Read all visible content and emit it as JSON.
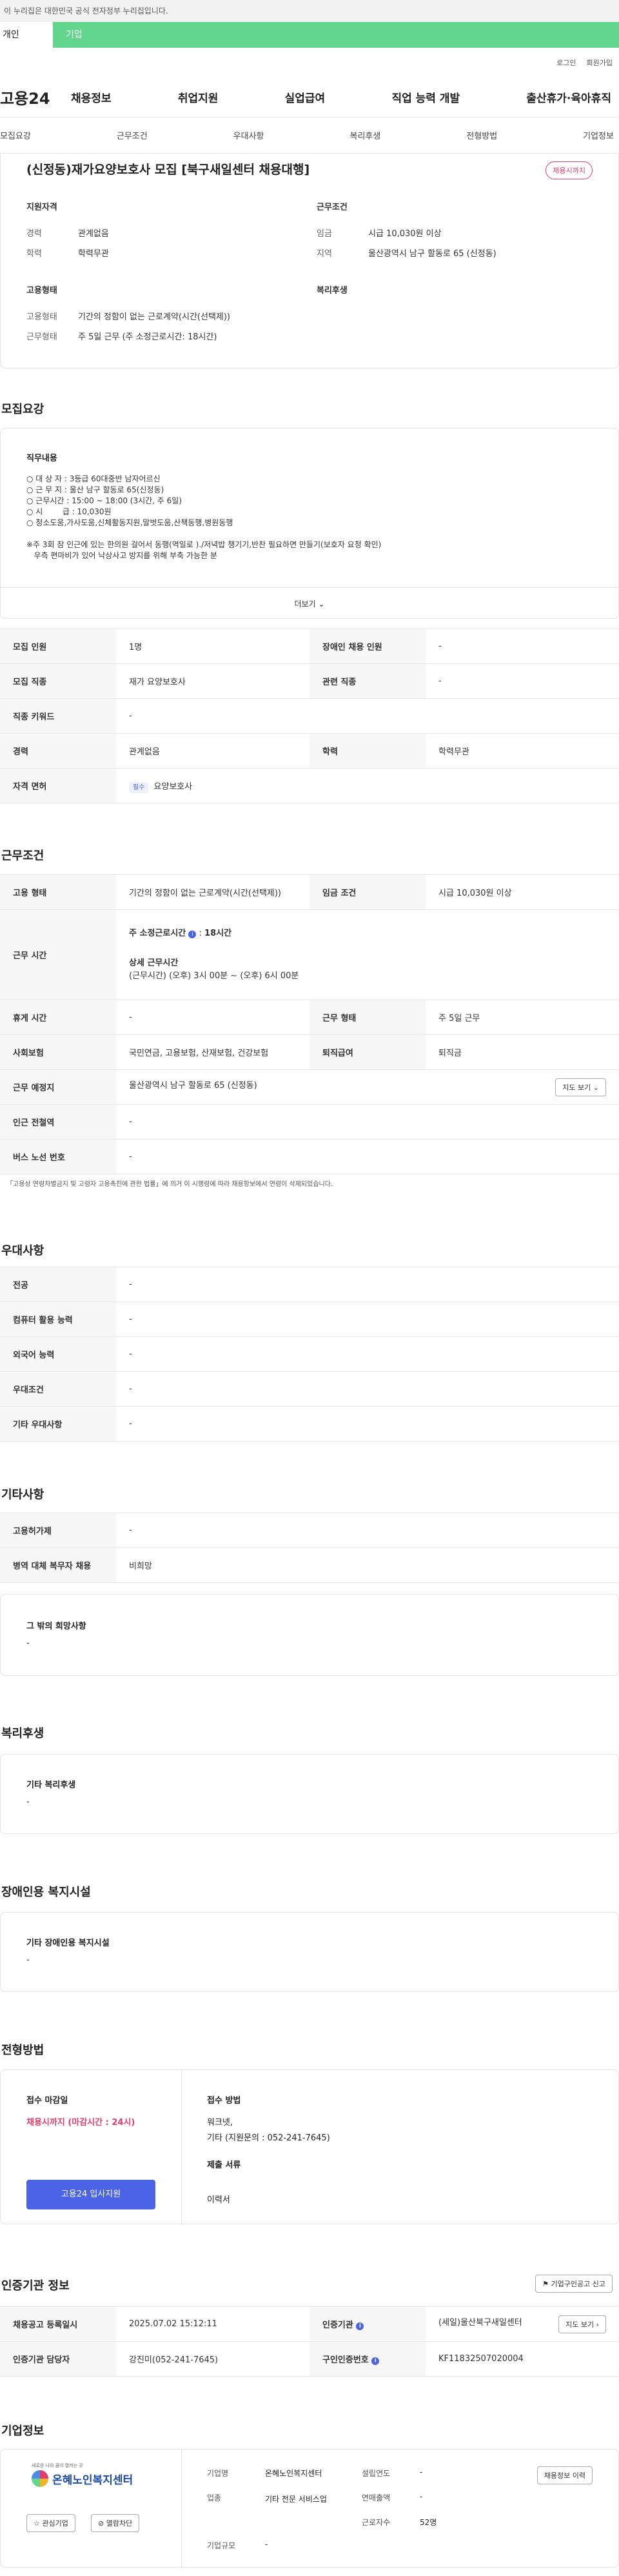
{
  "gov_notice": "이 누리집은 대한민국 공식 전자정부 누리집입니다.",
  "user_tabs": {
    "personal": "개인",
    "company": "기업"
  },
  "top_links": {
    "login": "로그인",
    "join": "회원가입"
  },
  "logo": "고용24",
  "gnb": [
    "채용정보",
    "취업지원",
    "실업급여",
    "직업 능력 개발",
    "출산휴가·육아휴직"
  ],
  "subnav": [
    "모집요강",
    "근무조건",
    "우대사항",
    "복리후생",
    "전형방법",
    "기업정보"
  ],
  "summary": {
    "title": "(신정동)재가요양보호사 모집 [북구새일센터 채용대행]",
    "badge": "채용시까지",
    "qual_title": "지원자격",
    "career_k": "경력",
    "career_v": "관계없음",
    "edu_k": "학력",
    "edu_v": "학력무관",
    "cond_title": "근무조건",
    "wage_k": "임금",
    "wage_v": "시급 10,030원 이상",
    "region_k": "지역",
    "region_v": "울산광역시 남구 할동로 65 (신정동)",
    "emp_title": "고용형태",
    "type_k": "고용형태",
    "type_v": "기간의 정함이 없는 근로계약(시간(선택제))",
    "work_k": "근무형태",
    "work_v": "주 5일 근무 (주 소정근로시간: 18시간)",
    "welfare_title": "복리후생"
  },
  "recruit": {
    "section": "모집요강",
    "duty_title": "직무내용",
    "duty_lines": [
      "○ 대 상 자 : 3등급 60대중반 남자어르신",
      "○ 근 무 지 : 울산 남구 할동로 65(신정동)",
      "○ 근무시간 : 15:00 ~ 18:00 (3시간, 주 6일)",
      "○ 시        급 : 10,030원",
      "○ 청소도움,가사도움,신체활동지원,말벗도움,산책동행,병원동행",
      "",
      "※주 3회 잠 인근에 있는 한의원 걸어서 동행(역일로 )./저녁밥 챙기기,반찬 필요하면 만들기(보호자 요청 확인)",
      "   우측 편마비가 있어 낙상사고 방지를 위해 부축 가능한 분"
    ],
    "more": "더보기",
    "rows": [
      {
        "k1": "모집 인원",
        "v1": "1명",
        "k2": "장애인 채용 인원",
        "v2": "-"
      },
      {
        "k1": "모집 직종",
        "v1": "재가 요양보호사",
        "k2": "관련 직종",
        "v2": "-"
      },
      {
        "k1": "직종 키워드",
        "v1": "-"
      },
      {
        "k1": "경력",
        "v1": "관계없음",
        "k2": "학력",
        "v2": "학력무관"
      },
      {
        "k1": "자격 면허",
        "v1_tag": "필수",
        "v1": "요양보호사"
      }
    ]
  },
  "conditions": {
    "section": "근무조건",
    "emp_k": "고용 형태",
    "emp_v": "기간의 정함이 없는 근로계약(시간(선택제))",
    "wage_k": "임금 조건",
    "wage_v": "시급 10,030원 이상",
    "time_k": "근무 시간",
    "time_week": "주 소정근로시간",
    "time_hours": "18시간",
    "time_detail_title": "상세 근무시간",
    "time_detail": "(근무시간) (오후) 3시 00분 ~ (오후) 6시 00분",
    "rest_k": "휴게 시간",
    "rest_v": "-",
    "form_k": "근무 형태",
    "form_v": "주 5일 근무",
    "ins_k": "사회보험",
    "ins_v": "국민연금, 고용보험, 산재보험, 건강보험",
    "ret_k": "퇴직급여",
    "ret_v": "퇴직금",
    "place_k": "근무 예정지",
    "place_v": "울산광역시 남구 할동로 65 (신정동)",
    "map_btn": "지도 보기",
    "station_k": "인근 전철역",
    "station_v": "-",
    "bus_k": "버스 노선 번호",
    "bus_v": "-",
    "note": "「고용상 연령차별금지 및 고령자 고용촉진에 관한 법률」에 의거 이 시행령에 따라 채용항보에서 연령이 삭제되었습니다."
  },
  "preference": {
    "section": "우대사항",
    "rows": [
      {
        "k": "전공",
        "v": "-"
      },
      {
        "k": "컴퓨터 활용 능력",
        "v": "-"
      },
      {
        "k": "외국어 능력",
        "v": "-"
      },
      {
        "k": "우대조건",
        "v": "-"
      },
      {
        "k": "기타 우대사항",
        "v": "-"
      }
    ]
  },
  "etc": {
    "section": "기타사항",
    "rows": [
      {
        "k": "고용허가제",
        "v": "-"
      },
      {
        "k": "병역 대체 복무자 채용",
        "v": "비희망"
      }
    ],
    "other_title": "그 밖의 희망사항",
    "other_v": "-"
  },
  "welfare": {
    "section": "복리후생",
    "title": "기타 복리후생",
    "v": "-"
  },
  "disabled": {
    "section": "장애인용 복지시설",
    "title": "기타 장애인용 복지시설",
    "v": "-"
  },
  "process": {
    "section": "전형방법",
    "deadline_title": "접수 마감일",
    "deadline_v": "채용시까지 (마감시간 : 24시)",
    "apply_btn": "고용24 입사지원",
    "method_title": "접수 방법",
    "method_v1": "워크넷,",
    "method_v2": "기타 (지원문의 : 052-241-7645)",
    "docs_title": "제출 서류",
    "docs_v": "이력서"
  },
  "cert": {
    "section": "인증기관 정보",
    "print_btn": "기업구인공고 신고",
    "reg_k": "채용공고 등록일시",
    "reg_v": "2025.07.02 15:12:11",
    "agency_k": "인증기관",
    "agency_v": "(세일)울산북구새일센터",
    "map_btn": "지도 보기",
    "manager_k": "인증기관 담당자",
    "manager_v": "강진미(052-241-7645)",
    "num_k": "구인인증번호",
    "num_v": "KF11832507020004"
  },
  "company": {
    "section": "기업정보",
    "logo_small": "새로운 나의 꿈이 열리는 곳",
    "logo_name": "온혜노인복지센터",
    "fav_btn": "관심기업",
    "block_btn": "열람차단",
    "name_k": "기업명",
    "name_v": "온혜노인복지센터",
    "ind_k": "업종",
    "ind_v": "기타 전문 서비스업",
    "size_k": "기업규모",
    "size_v": "-",
    "est_k": "설립연도",
    "est_v": "-",
    "sales_k": "연매출액",
    "sales_v": "-",
    "emp_k": "근로자수",
    "emp_v": "52명",
    "detail_btn": "채용정보 이력"
  },
  "colors": {
    "accent": "#62d68c",
    "badge": "#e23d6b",
    "apply": "#4a63e7"
  }
}
